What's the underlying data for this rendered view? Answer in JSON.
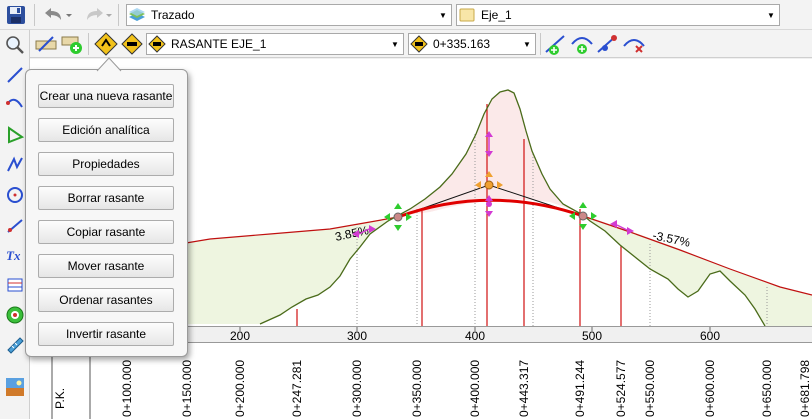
{
  "toolbar": {
    "layer_combo": {
      "value": "Trazado"
    },
    "axis_combo": {
      "value": "Eje_1"
    },
    "grade_combo": {
      "value": "RASANTE EJE_1"
    },
    "station_combo": {
      "value": "0+335.163"
    }
  },
  "popup_menu": {
    "items": [
      "Crear una nueva rasante",
      "Edición analítica",
      "Propiedades",
      "Borrar rasante",
      "Copiar rasante",
      "Mover rasante",
      "Ordenar rasantes",
      "Invertir rasante"
    ]
  },
  "profile": {
    "slope_left": "3.85%",
    "slope_right": "-3.57%",
    "ruler_ticks": [
      "200",
      "300",
      "400",
      "500",
      "600"
    ],
    "pk_header": "P.K.",
    "stations": [
      "0+100.000",
      "0+150.000",
      "0+200.000",
      "0+247.281",
      "0+300.000",
      "0+350.000",
      "0+400.000",
      "0+443.317",
      "0+491.244",
      "0+524.577",
      "0+550.000",
      "0+600.000",
      "0+650.000",
      "0+681.798"
    ]
  },
  "colors": {
    "grade_line": "#e00000",
    "terrain_line": "#4a6b1a",
    "cut_fill": "#fbe9e9",
    "fill_fill": "#eef5e0",
    "handle_green": "#2ecc2e",
    "handle_magenta": "#d23ad2",
    "handle_orange": "#f0a030"
  },
  "icons": [
    "save-icon",
    "undo-icon",
    "redo-icon",
    "layer-icon",
    "folder-icon",
    "zoom-icon"
  ]
}
